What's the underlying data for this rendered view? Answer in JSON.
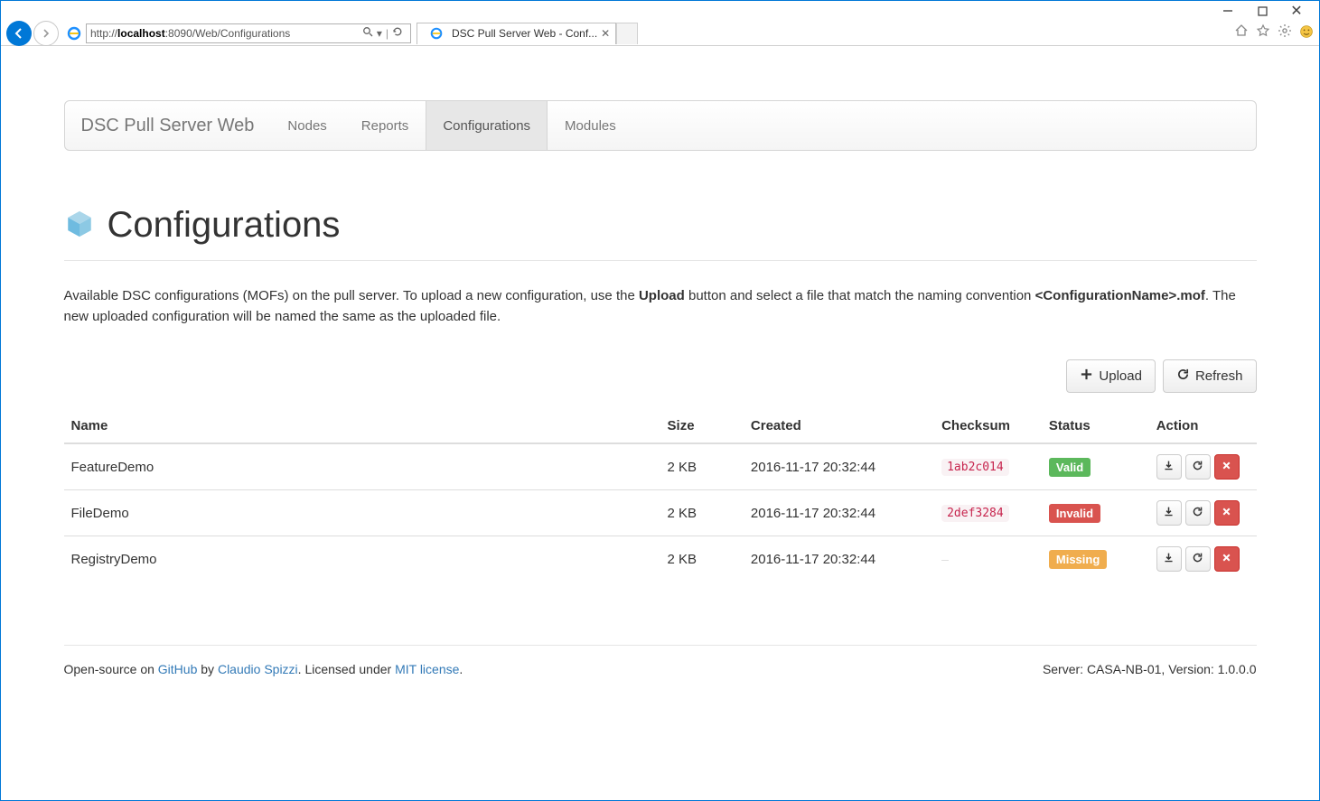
{
  "browser": {
    "url_prefix": "http://",
    "url_host": "localhost",
    "url_suffix": ":8090/Web/Configurations",
    "tab_title": "DSC Pull Server Web - Conf...",
    "search_glyph": "🔍"
  },
  "navbar": {
    "brand": "DSC Pull Server Web",
    "items": [
      {
        "label": "Nodes",
        "active": false
      },
      {
        "label": "Reports",
        "active": false
      },
      {
        "label": "Configurations",
        "active": true
      },
      {
        "label": "Modules",
        "active": false
      }
    ]
  },
  "page": {
    "title": "Configurations",
    "desc_before": "Available DSC configurations (MOFs) on the pull server. To upload a new configuration, use the ",
    "desc_bold1": "Upload",
    "desc_mid": " button and select a file that match the naming convention ",
    "desc_bold2": "<ConfigurationName>.mof",
    "desc_after": ". The new uploaded configuration will be named the same as the uploaded file."
  },
  "buttons": {
    "upload": "Upload",
    "refresh": "Refresh"
  },
  "table": {
    "headers": {
      "name": "Name",
      "size": "Size",
      "created": "Created",
      "checksum": "Checksum",
      "status": "Status",
      "action": "Action"
    },
    "rows": [
      {
        "name": "FeatureDemo",
        "size": "2 KB",
        "created": "2016-11-17 20:32:44",
        "checksum": "1ab2c014",
        "status": "Valid",
        "status_class": "valid"
      },
      {
        "name": "FileDemo",
        "size": "2 KB",
        "created": "2016-11-17 20:32:44",
        "checksum": "2def3284",
        "status": "Invalid",
        "status_class": "invalid"
      },
      {
        "name": "RegistryDemo",
        "size": "2 KB",
        "created": "2016-11-17 20:32:44",
        "checksum": "",
        "status": "Missing",
        "status_class": "missing"
      }
    ]
  },
  "footer": {
    "text1": "Open-source on ",
    "link1": "GitHub",
    "text2": " by ",
    "link2": "Claudio Spizzi",
    "text3": ". Licensed under ",
    "link3": "MIT license",
    "text4": ".",
    "right": "Server: CASA-NB-01, Version: 1.0.0.0"
  }
}
